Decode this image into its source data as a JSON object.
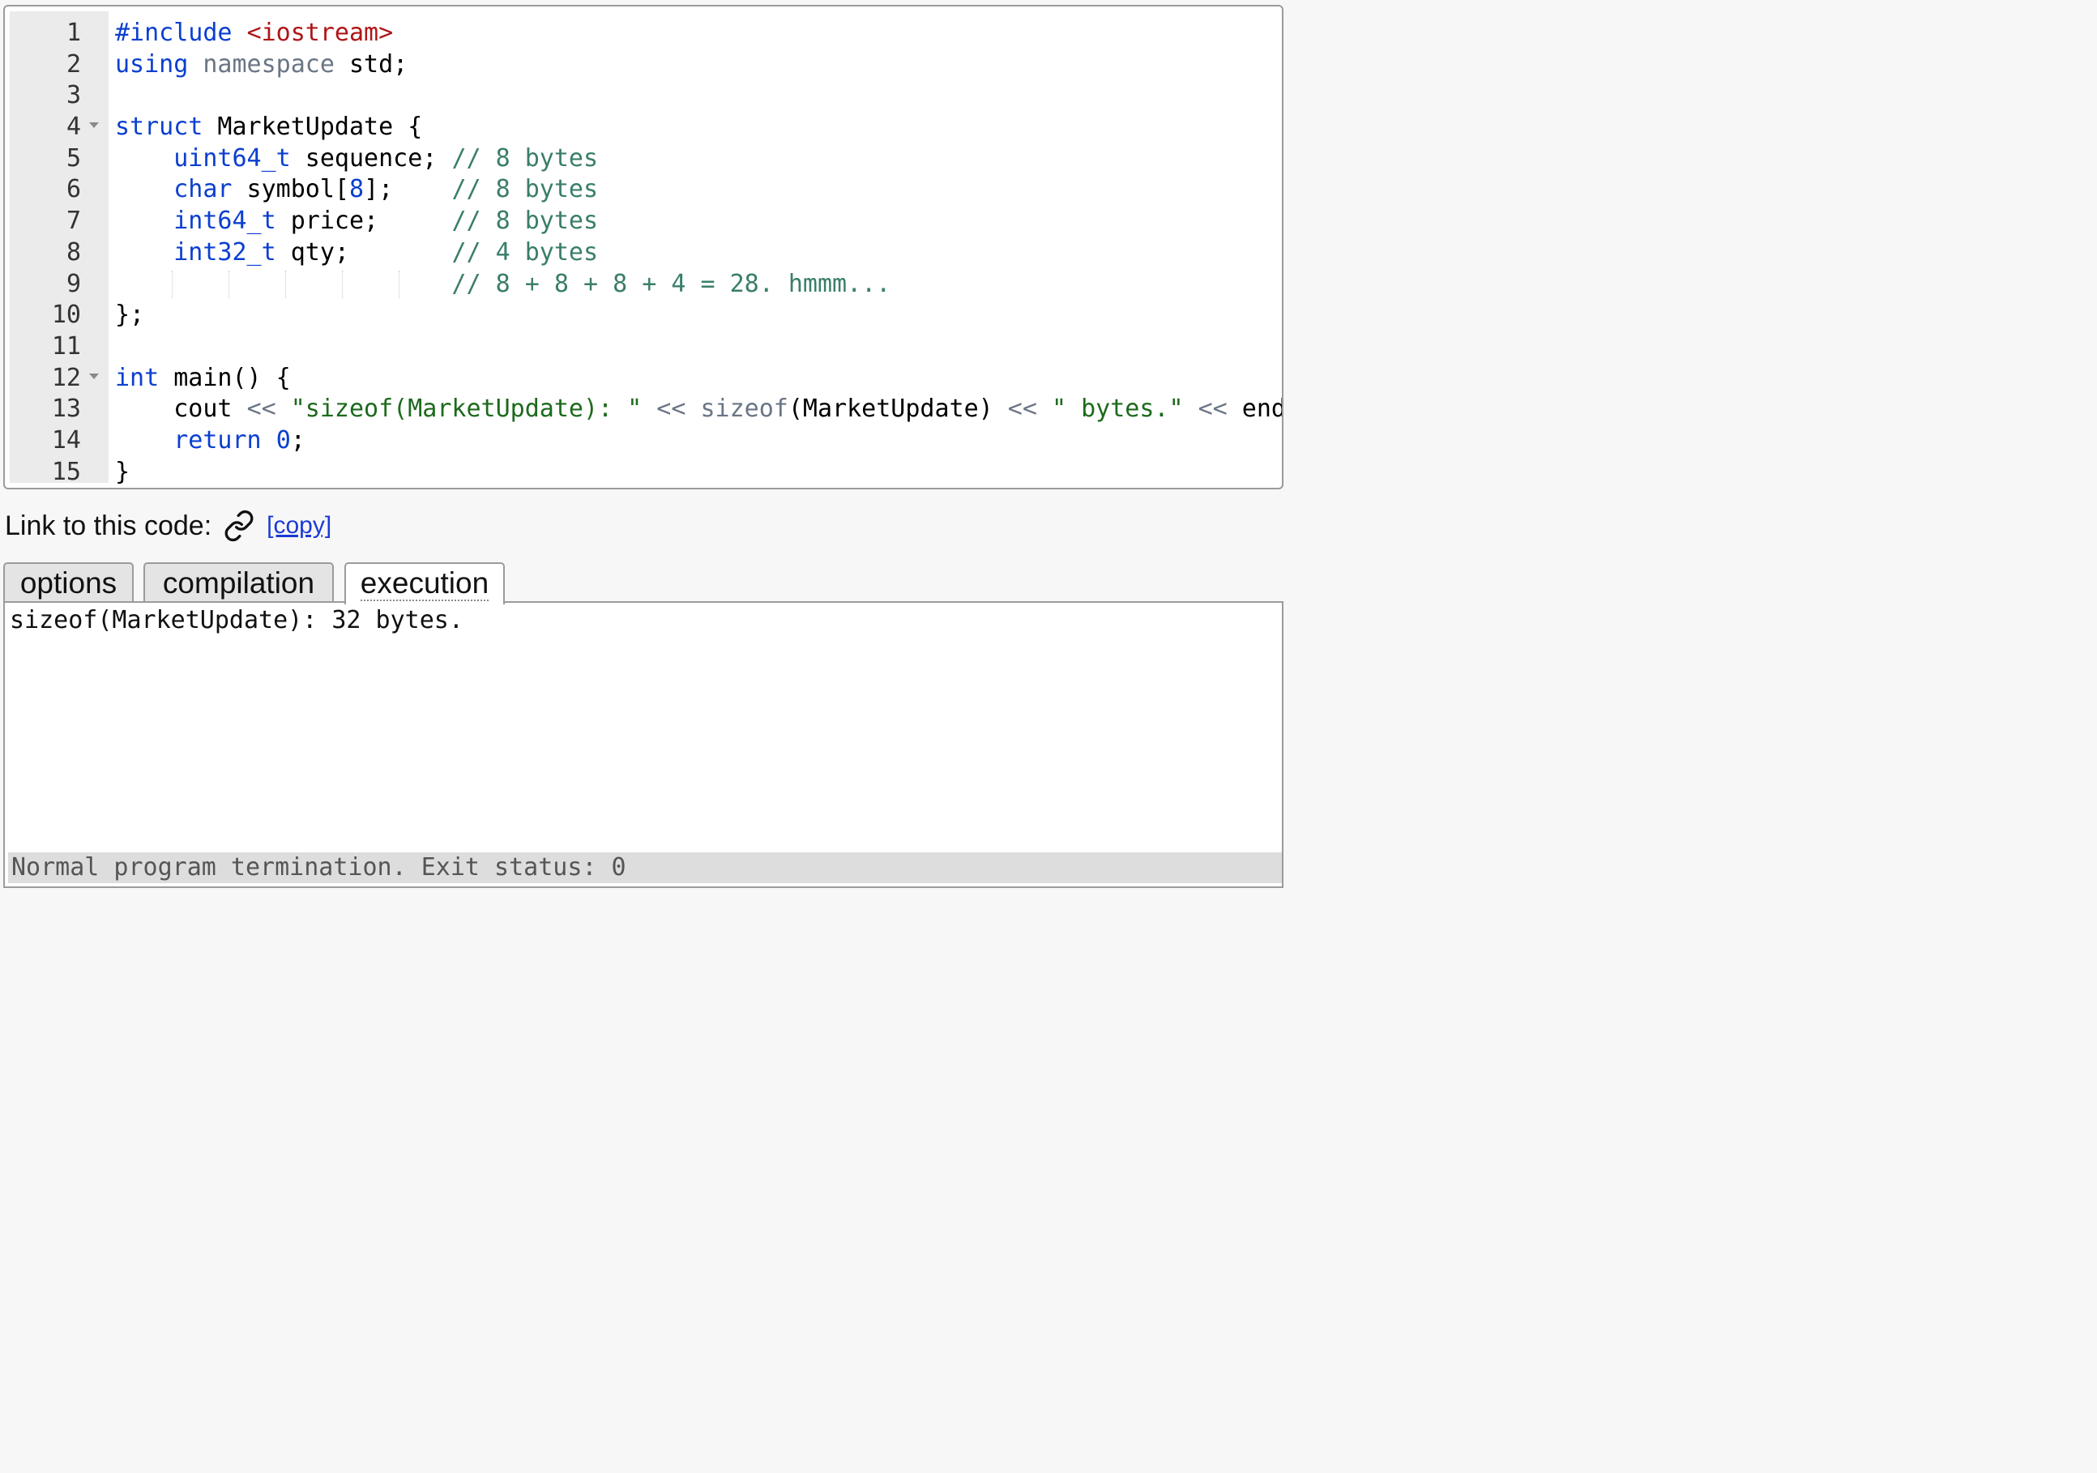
{
  "editor": {
    "lines": [
      {
        "num": "1",
        "fold": false,
        "tokens": [
          [
            "#include",
            "kw"
          ],
          [
            " ",
            ""
          ],
          [
            "<iostream>",
            "inc"
          ]
        ]
      },
      {
        "num": "2",
        "fold": false,
        "tokens": [
          [
            "using",
            "kw"
          ],
          [
            " ",
            ""
          ],
          [
            "namespace",
            "gr"
          ],
          [
            " std;",
            ""
          ]
        ]
      },
      {
        "num": "3",
        "fold": false,
        "tokens": []
      },
      {
        "num": "4",
        "fold": true,
        "tokens": [
          [
            "struct",
            "kw"
          ],
          [
            " MarketUpdate {",
            ""
          ]
        ]
      },
      {
        "num": "5",
        "fold": false,
        "tokens": [
          [
            "    ",
            ""
          ],
          [
            "uint64_t",
            "kw"
          ],
          [
            " sequence; ",
            ""
          ],
          [
            "// 8 bytes",
            "cm"
          ]
        ]
      },
      {
        "num": "6",
        "fold": false,
        "tokens": [
          [
            "    ",
            ""
          ],
          [
            "char",
            "kw"
          ],
          [
            " symbol[",
            ""
          ],
          [
            "8",
            "nm"
          ],
          [
            "];    ",
            ""
          ],
          [
            "// 8 bytes",
            "cm"
          ]
        ]
      },
      {
        "num": "7",
        "fold": false,
        "tokens": [
          [
            "    ",
            ""
          ],
          [
            "int64_t",
            "kw"
          ],
          [
            " price;     ",
            ""
          ],
          [
            "// 8 bytes",
            "cm"
          ]
        ]
      },
      {
        "num": "8",
        "fold": false,
        "tokens": [
          [
            "    ",
            ""
          ],
          [
            "int32_t",
            "kw"
          ],
          [
            " qty;       ",
            ""
          ],
          [
            "// 4 bytes",
            "cm"
          ]
        ]
      },
      {
        "num": "9",
        "fold": false,
        "guides": true,
        "tokens": [
          [
            "                       ",
            ""
          ],
          [
            "// 8 + 8 + 8 + 4 = 28. hmmm...",
            "cm"
          ]
        ]
      },
      {
        "num": "10",
        "fold": false,
        "tokens": [
          [
            "};",
            ""
          ]
        ]
      },
      {
        "num": "11",
        "fold": false,
        "tokens": []
      },
      {
        "num": "12",
        "fold": true,
        "tokens": [
          [
            "int",
            "kw"
          ],
          [
            " main() {",
            ""
          ]
        ]
      },
      {
        "num": "13",
        "fold": false,
        "tokens": [
          [
            "    cout ",
            ""
          ],
          [
            "<<",
            "gr"
          ],
          [
            " ",
            ""
          ],
          [
            "\"sizeof(MarketUpdate): \"",
            "st"
          ],
          [
            " ",
            ""
          ],
          [
            "<<",
            "gr"
          ],
          [
            " ",
            ""
          ],
          [
            "sizeof",
            "gr"
          ],
          [
            "(MarketUpdate) ",
            ""
          ],
          [
            "<<",
            "gr"
          ],
          [
            " ",
            ""
          ],
          [
            "\" bytes.\"",
            "st"
          ],
          [
            " ",
            ""
          ],
          [
            "<<",
            "gr"
          ],
          [
            " endl;",
            ""
          ]
        ]
      },
      {
        "num": "14",
        "fold": false,
        "tokens": [
          [
            "    ",
            ""
          ],
          [
            "return",
            "kw"
          ],
          [
            " ",
            ""
          ],
          [
            "0",
            "nm"
          ],
          [
            ";",
            ""
          ]
        ]
      },
      {
        "num": "15",
        "fold": false,
        "tokens": [
          [
            "}",
            ""
          ]
        ]
      }
    ]
  },
  "link": {
    "label": "Link to this code:",
    "icon": "link-icon",
    "copy_label": "[copy]"
  },
  "tabs": [
    {
      "label": "options",
      "active": false
    },
    {
      "label": "compilation",
      "active": false
    },
    {
      "label": "execution",
      "active": true
    }
  ],
  "output": {
    "text": "sizeof(MarketUpdate): 32 bytes.",
    "status": "Normal program termination. Exit status: 0"
  },
  "colors": {
    "keyword": "#0b3fd0",
    "include": "#b01515",
    "comment": "#3a7e6a",
    "string": "#1c6a1c",
    "operator": "#6a7585",
    "link": "#1a3ad6"
  }
}
